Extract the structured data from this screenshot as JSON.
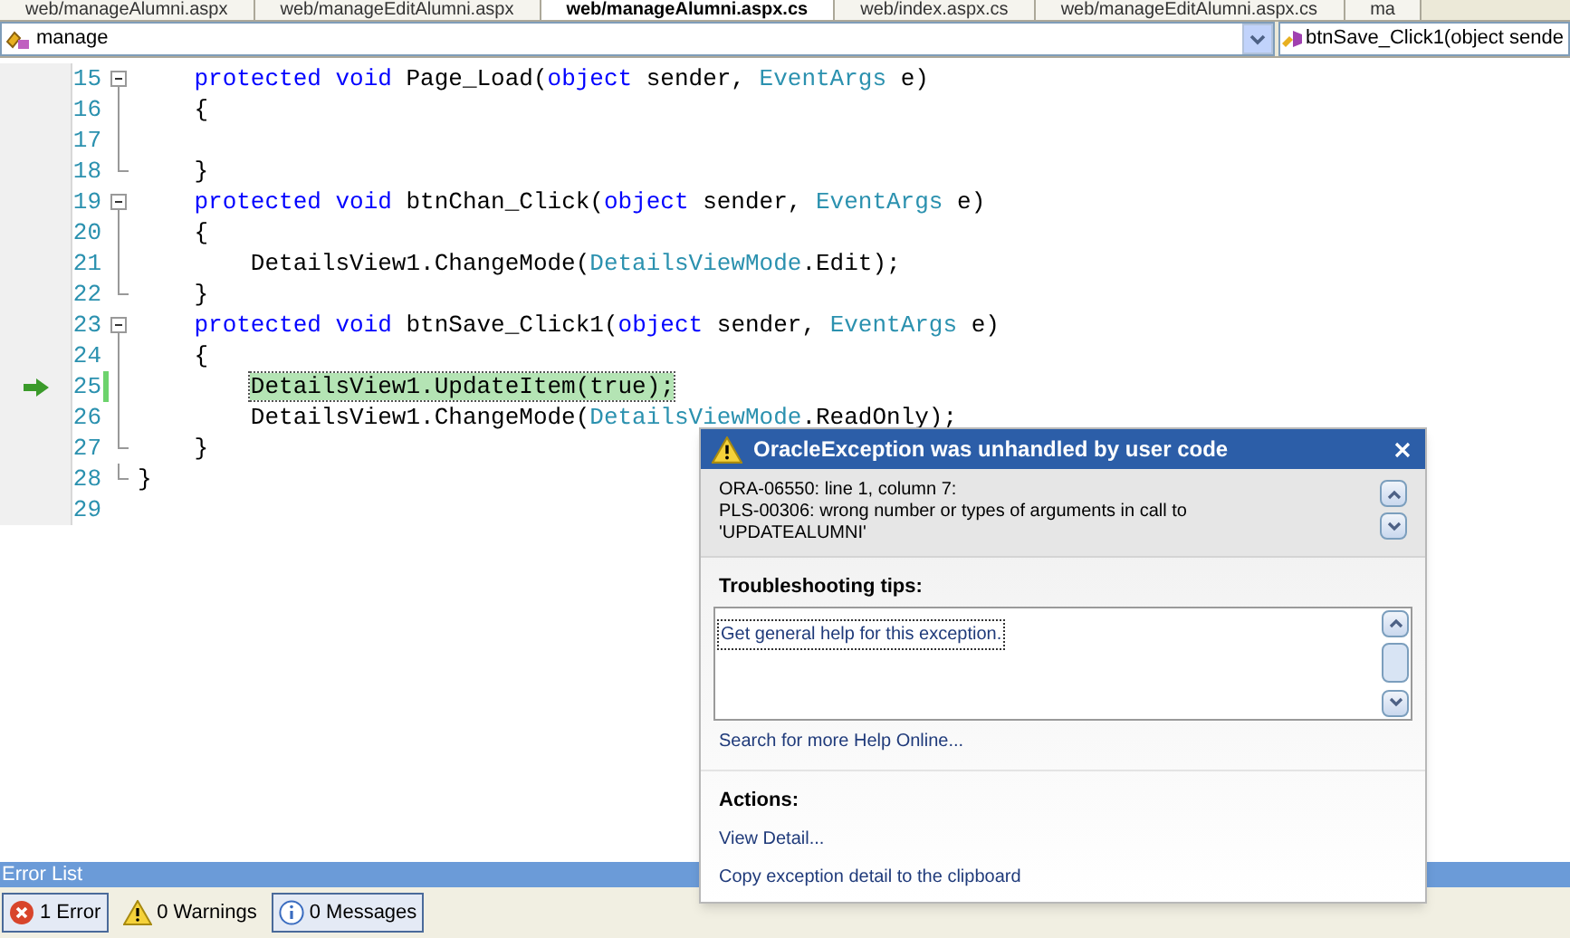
{
  "document_tabs": [
    {
      "label": "web/manageAlumni.aspx",
      "selected": false
    },
    {
      "label": "web/manageEditAlumni.aspx",
      "selected": false
    },
    {
      "label": "web/manageAlumni.aspx.cs",
      "selected": true
    },
    {
      "label": "web/index.aspx.cs",
      "selected": false
    },
    {
      "label": "web/manageEditAlumni.aspx.cs",
      "selected": false
    },
    {
      "label": "ma",
      "selected": false
    }
  ],
  "navigation_bar": {
    "type_dropdown": "manage",
    "member_dropdown": "btnSave_Click1(object sende"
  },
  "editor": {
    "lines": [
      {
        "number": "15",
        "kind": "fold_start",
        "current": false,
        "modified": false,
        "tokens": [
          {
            "kind": "keyword",
            "text": "    protected void "
          },
          {
            "kind": "plain",
            "text": "Page_Load("
          },
          {
            "kind": "keyword",
            "text": "object "
          },
          {
            "kind": "plain",
            "text": "sender, "
          },
          {
            "kind": "type",
            "text": "EventArgs "
          },
          {
            "kind": "plain",
            "text": "e)"
          }
        ]
      },
      {
        "number": "16",
        "kind": "fold_line",
        "current": false,
        "modified": false,
        "tokens": [
          {
            "kind": "plain",
            "text": "    {"
          }
        ]
      },
      {
        "number": "17",
        "kind": "fold_line",
        "current": false,
        "modified": false
      },
      {
        "number": "18",
        "kind": "fold_end",
        "current": false,
        "modified": false,
        "tokens": [
          {
            "kind": "plain",
            "text": "    }"
          }
        ]
      },
      {
        "number": "19",
        "kind": "fold_start",
        "current": false,
        "modified": false,
        "tokens": [
          {
            "kind": "keyword",
            "text": "    protected void "
          },
          {
            "kind": "plain",
            "text": "btnChan_Click("
          },
          {
            "kind": "keyword",
            "text": "object "
          },
          {
            "kind": "plain",
            "text": "sender, "
          },
          {
            "kind": "type",
            "text": "EventArgs "
          },
          {
            "kind": "plain",
            "text": "e)"
          }
        ]
      },
      {
        "number": "20",
        "kind": "fold_line",
        "current": false,
        "modified": false,
        "tokens": [
          {
            "kind": "plain",
            "text": "    {"
          }
        ]
      },
      {
        "number": "21",
        "kind": "fold_line",
        "current": false,
        "modified": false,
        "tokens": [
          {
            "kind": "plain",
            "text": "        DetailsView1.ChangeMode("
          },
          {
            "kind": "type",
            "text": "DetailsViewMode"
          },
          {
            "kind": "plain",
            "text": ".Edit);"
          }
        ]
      },
      {
        "number": "22",
        "kind": "fold_end",
        "current": false,
        "modified": false,
        "tokens": [
          {
            "kind": "plain",
            "text": "    }"
          }
        ]
      },
      {
        "number": "23",
        "kind": "fold_start",
        "current": false,
        "modified": false,
        "tokens": [
          {
            "kind": "keyword",
            "text": "    protected void "
          },
          {
            "kind": "plain",
            "text": "btnSave_Click1("
          },
          {
            "kind": "keyword",
            "text": "object "
          },
          {
            "kind": "plain",
            "text": "sender, "
          },
          {
            "kind": "type",
            "text": "EventArgs "
          },
          {
            "kind": "plain",
            "text": "e)"
          }
        ]
      },
      {
        "number": "24",
        "kind": "fold_line",
        "current": false,
        "modified": false,
        "tokens": [
          {
            "kind": "plain",
            "text": "    {"
          }
        ]
      },
      {
        "number": "25",
        "kind": "fold_line",
        "current": true,
        "modified": true,
        "tokens": [
          {
            "kind": "plain",
            "text": "        DetailsView1.UpdateItem(true);"
          }
        ]
      },
      {
        "number": "26",
        "kind": "fold_line",
        "current": false,
        "modified": false,
        "tokens": [
          {
            "kind": "plain",
            "text": "        DetailsView1.ChangeMode("
          },
          {
            "kind": "type",
            "text": "DetailsViewMode"
          },
          {
            "kind": "plain",
            "text": ".ReadOnly);"
          }
        ]
      },
      {
        "number": "27",
        "kind": "fold_end",
        "current": false,
        "modified": false,
        "tokens": [
          {
            "kind": "plain",
            "text": "    }"
          }
        ]
      },
      {
        "number": "28",
        "kind": "fold_end",
        "current": false,
        "modified": false,
        "tokens": [
          {
            "kind": "plain",
            "text": "}"
          }
        ]
      },
      {
        "number": "29",
        "kind": "plain",
        "current": false,
        "modified": false
      }
    ]
  },
  "exception_popup": {
    "title": "OracleException was unhandled by user code",
    "message": [
      "ORA-06550: line 1, column 7:",
      "PLS-00306: wrong number or types of arguments in call to 'UPDATEALUMNI'"
    ],
    "tips_heading": "Troubleshooting tips:",
    "tips": [
      {
        "label": "Get general help for this exception.",
        "selected": true
      }
    ],
    "help_link": "Search for more Help Online...",
    "actions_heading": "Actions:",
    "actions": [
      "View Detail...",
      "Copy exception detail to the clipboard"
    ]
  },
  "error_list": {
    "title": "Error List",
    "filters": [
      {
        "kind": "error",
        "label": "1 Error",
        "selected": true
      },
      {
        "kind": "warning",
        "label": "0 Warnings",
        "selected": false
      },
      {
        "kind": "message",
        "label": "0 Messages",
        "selected": true
      }
    ]
  }
}
